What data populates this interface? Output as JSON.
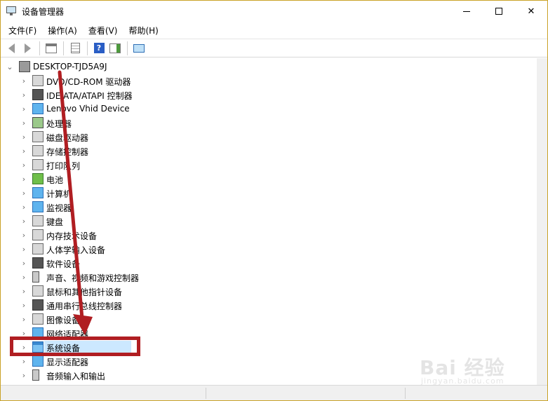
{
  "window": {
    "title": "设备管理器",
    "border_color": "#c9a227"
  },
  "menu": [
    {
      "label": "文件(F)"
    },
    {
      "label": "操作(A)"
    },
    {
      "label": "查看(V)"
    },
    {
      "label": "帮助(H)"
    }
  ],
  "toolbar": {
    "icons": [
      "back-arrow-icon",
      "forward-arrow-icon",
      "properties-icon",
      "view-icon",
      "help-icon",
      "action-icon",
      "scan-monitor-icon"
    ]
  },
  "tree": {
    "root": {
      "label": "DESKTOP-TJD5A9J",
      "expanded": true
    },
    "items": [
      {
        "label": "DVD/CD-ROM 驱动器",
        "icon": "dvd-drive-icon"
      },
      {
        "label": "IDE ATA/ATAPI 控制器",
        "icon": "ide-controller-icon"
      },
      {
        "label": "Lenovo Vhid Device",
        "icon": "monitor-icon"
      },
      {
        "label": "处理器",
        "icon": "cpu-icon"
      },
      {
        "label": "磁盘驱动器",
        "icon": "disk-drive-icon"
      },
      {
        "label": "存储控制器",
        "icon": "storage-controller-icon"
      },
      {
        "label": "打印队列",
        "icon": "printer-icon"
      },
      {
        "label": "电池",
        "icon": "battery-icon"
      },
      {
        "label": "计算机",
        "icon": "computer-icon"
      },
      {
        "label": "监视器",
        "icon": "monitor-icon"
      },
      {
        "label": "键盘",
        "icon": "keyboard-icon"
      },
      {
        "label": "内存技术设备",
        "icon": "memory-device-icon"
      },
      {
        "label": "人体学输入设备",
        "icon": "hid-icon"
      },
      {
        "label": "软件设备",
        "icon": "software-device-icon"
      },
      {
        "label": "声音、视频和游戏控制器",
        "icon": "speaker-icon"
      },
      {
        "label": "鼠标和其他指针设备",
        "icon": "mouse-icon"
      },
      {
        "label": "通用串行总线控制器",
        "icon": "usb-icon"
      },
      {
        "label": "图像设备",
        "icon": "camera-icon"
      },
      {
        "label": "网络适配器",
        "icon": "network-adapter-icon"
      },
      {
        "label": "系统设备",
        "icon": "system-device-icon",
        "selected": true
      },
      {
        "label": "显示适配器",
        "icon": "display-adapter-icon"
      },
      {
        "label": "音频输入和输出",
        "icon": "audio-io-icon"
      }
    ]
  },
  "annotation": {
    "color": "#b01e22"
  },
  "watermark": {
    "text": "Bai 经验",
    "sub": "jingyan.baidu.com"
  }
}
